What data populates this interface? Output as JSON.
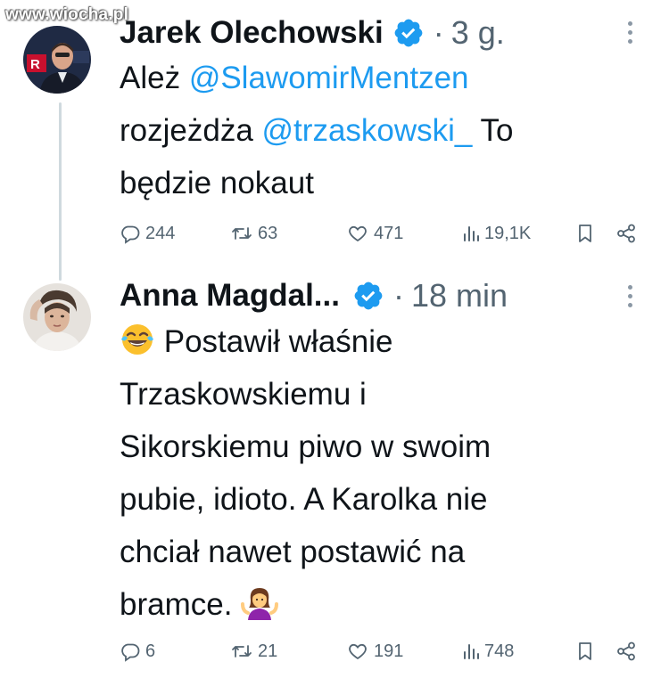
{
  "watermark": "www.wiocha.pl",
  "tweets": [
    {
      "author": "Jarek Olechowski",
      "separator": "·",
      "time": "3 g.",
      "text": {
        "t1": "Ależ ",
        "mention1": "@SlawomirMentzen",
        "t2": "rozjeżdża ",
        "mention2": "@trzaskowski_",
        "t3": " To",
        "t4": "będzie nokaut"
      },
      "stats": {
        "replies": "244",
        "reposts": "63",
        "likes": "471",
        "views": "19,1K"
      }
    },
    {
      "author": "Anna Magdal...",
      "separator": "·",
      "time": "18 min",
      "text": {
        "emoji1": "laughing-crying-emoji",
        "l1": "Postawił właśnie",
        "l2": "Trzaskowskiemu i",
        "l3": "Sikorskiemu piwo w swoim",
        "l4": "pubie, idioto. A Karolka nie",
        "l5": "chciał nawet postawić na",
        "l6": "bramce.",
        "emoji2": "shrugging-woman-emoji"
      },
      "stats": {
        "replies": "6",
        "reposts": "21",
        "likes": "191",
        "views": "748"
      }
    }
  ],
  "colors": {
    "accent": "#1d9bf0",
    "muted": "#536471",
    "text": "#0f1419",
    "thread": "#cfd9de"
  }
}
